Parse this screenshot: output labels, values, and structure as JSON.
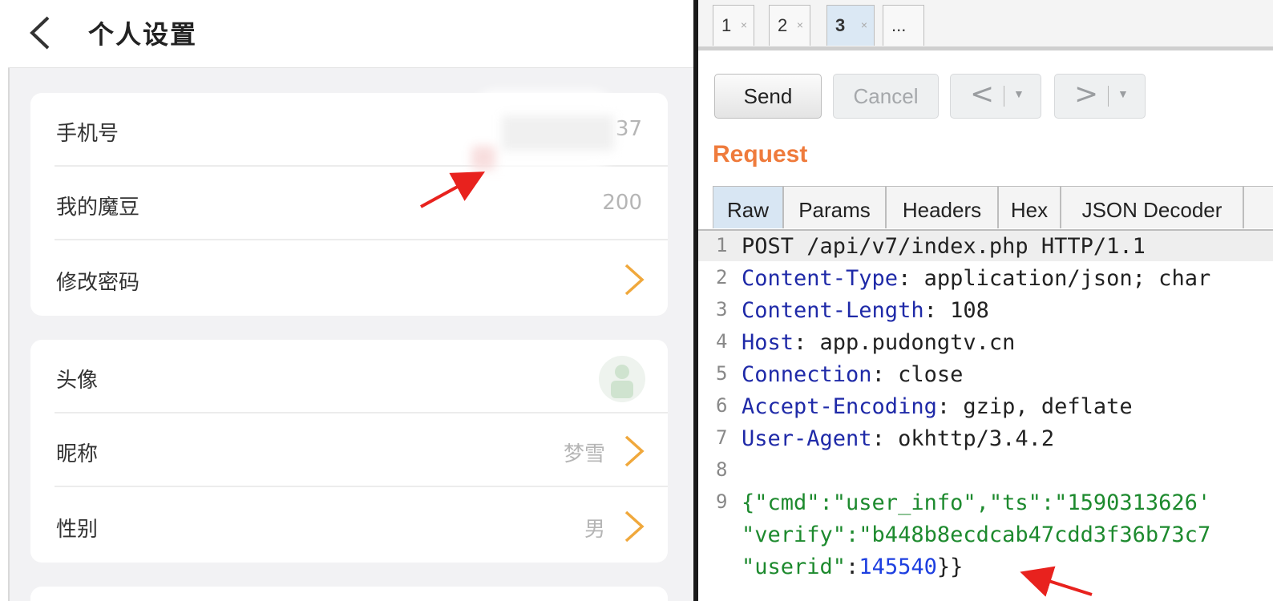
{
  "phone": {
    "title": "个人设置",
    "card1": [
      {
        "label": "手机号",
        "value": "37"
      },
      {
        "label": "我的魔豆",
        "value": "200"
      },
      {
        "label": "修改密码",
        "value": ""
      }
    ],
    "card2": [
      {
        "label": "头像",
        "value": ""
      },
      {
        "label": "昵称",
        "value": "梦雪"
      },
      {
        "label": "性别",
        "value": "男"
      }
    ]
  },
  "repeater": {
    "tabs": [
      {
        "label": "1",
        "close": "×"
      },
      {
        "label": "2",
        "close": "×"
      },
      {
        "label": "3",
        "close": "×"
      },
      {
        "label": "...",
        "close": ""
      }
    ],
    "active_tab": 2,
    "buttons": {
      "send": "Send",
      "cancel": "Cancel",
      "back": "<",
      "forward": ">",
      "dropdown": "▼"
    },
    "request_title": "Request",
    "subtabs": [
      "Raw",
      "Params",
      "Headers",
      "Hex",
      "JSON Decoder"
    ],
    "active_subtab": 0,
    "lines": [
      {
        "n": "1",
        "text": "POST /api/v7/index.php HTTP/1.1"
      },
      {
        "n": "2",
        "key": "Content-Type",
        "val": ": application/json; char"
      },
      {
        "n": "3",
        "key": "Content-Length",
        "val": ": 108"
      },
      {
        "n": "4",
        "key": "Host",
        "val": ": app.pudongtv.cn"
      },
      {
        "n": "5",
        "key": "Connection",
        "val": ": close"
      },
      {
        "n": "6",
        "key": "Accept-Encoding",
        "val": ": gzip, deflate"
      },
      {
        "n": "7",
        "key": "User-Agent",
        "val": ": okhttp/3.4.2"
      },
      {
        "n": "8",
        "text": ""
      },
      {
        "n": "9",
        "body1": "{\"cmd\":\"user_info\",\"ts\":\"1590313626'"
      },
      {
        "n": "",
        "body2": "\"verify\":\"b448b8ecdcab47cdd3f36b73c7"
      },
      {
        "n": "",
        "body3a": "\"userid\"",
        "body3b": ":",
        "body3c": "145540",
        "body3d": "}}"
      }
    ]
  }
}
